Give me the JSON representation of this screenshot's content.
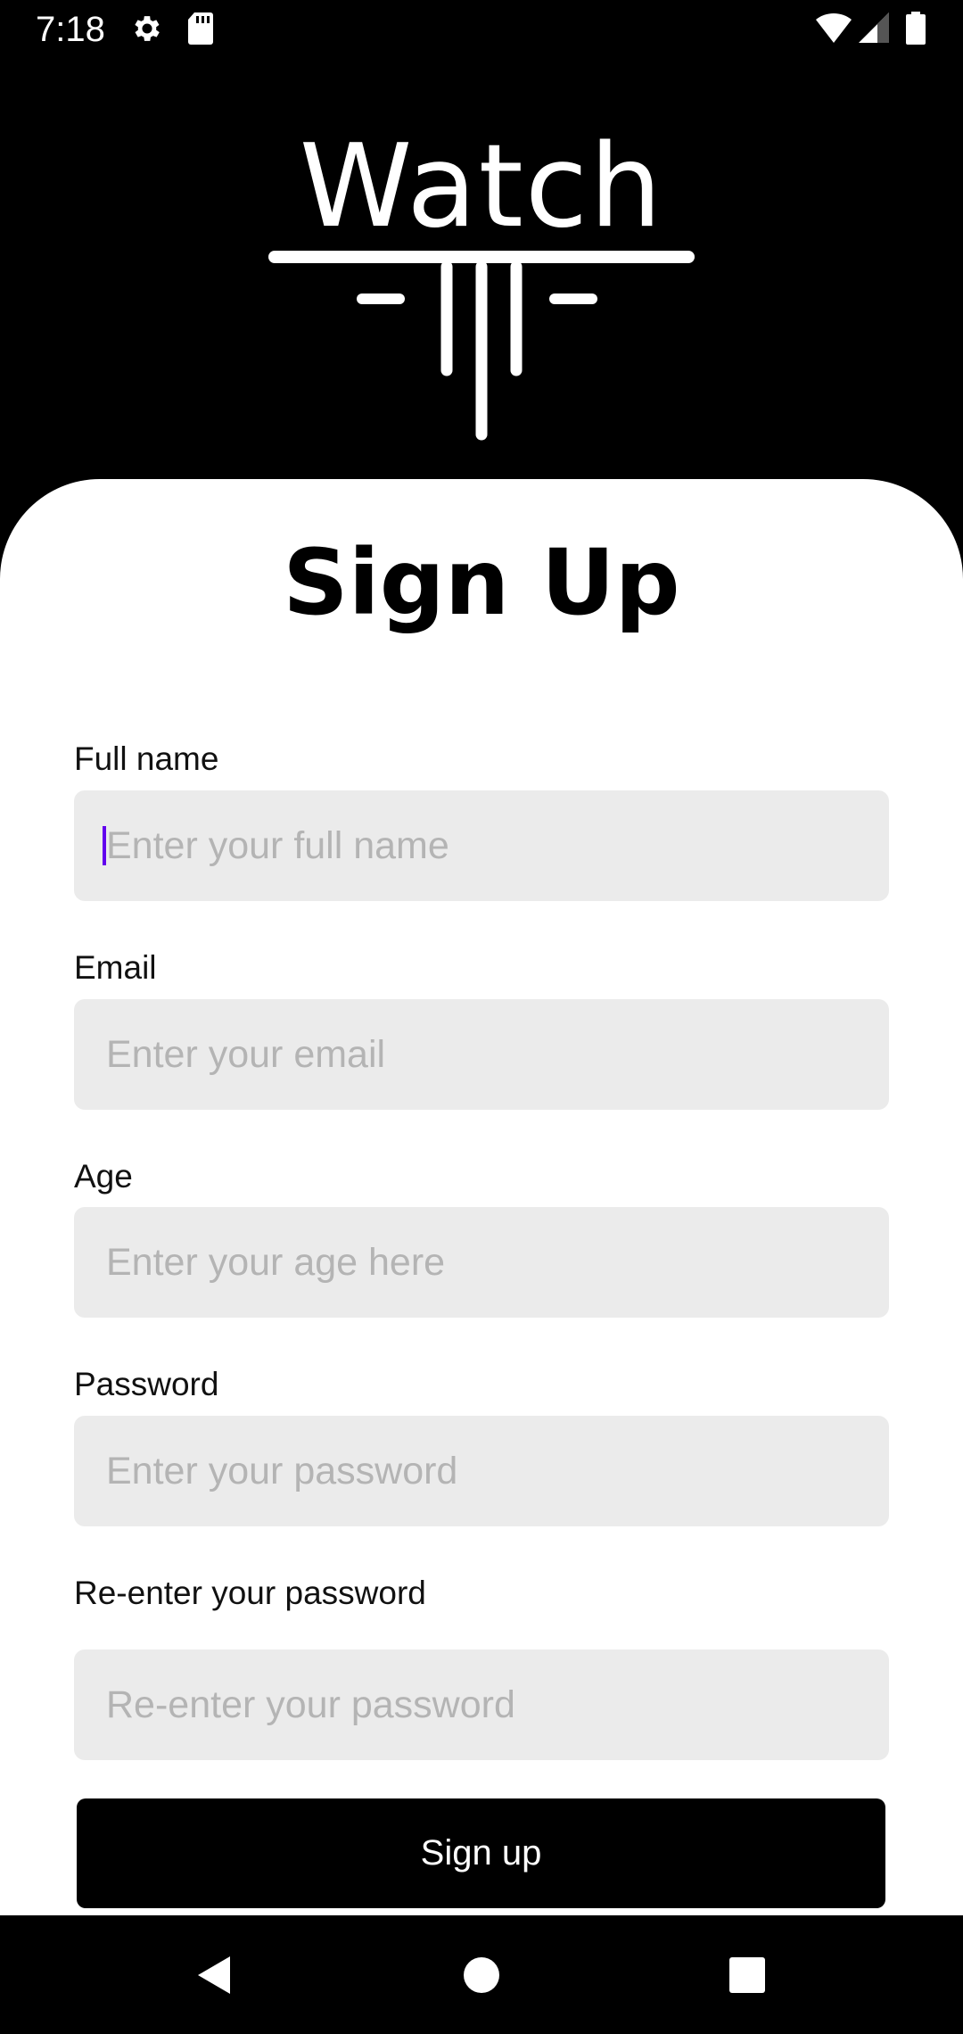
{
  "status_bar": {
    "time": "7:18",
    "icons": [
      "gear-icon",
      "sd-card-icon",
      "wifi-icon",
      "cell-signal-icon",
      "battery-icon"
    ]
  },
  "logo": {
    "text": "Watch"
  },
  "page": {
    "title": "Sign Up"
  },
  "form": {
    "fields": [
      {
        "label": "Full name",
        "placeholder": "Enter your full name",
        "value": ""
      },
      {
        "label": "Email",
        "placeholder": "Enter your email",
        "value": ""
      },
      {
        "label": "Age",
        "placeholder": "Enter your age here",
        "value": ""
      },
      {
        "label": "Password",
        "placeholder": "Enter your password",
        "value": ""
      },
      {
        "label": "Re-enter your password",
        "placeholder": "Re-enter your password",
        "value": ""
      }
    ],
    "submit_label": "Sign up"
  },
  "nav_bar": {
    "icons": [
      "back-icon",
      "home-icon",
      "recents-icon"
    ]
  },
  "colors": {
    "background": "#000000",
    "card": "#ffffff",
    "input_background": "#ebebeb",
    "placeholder": "#b4b4b4",
    "cursor": "#6200ee",
    "button": "#000000"
  }
}
